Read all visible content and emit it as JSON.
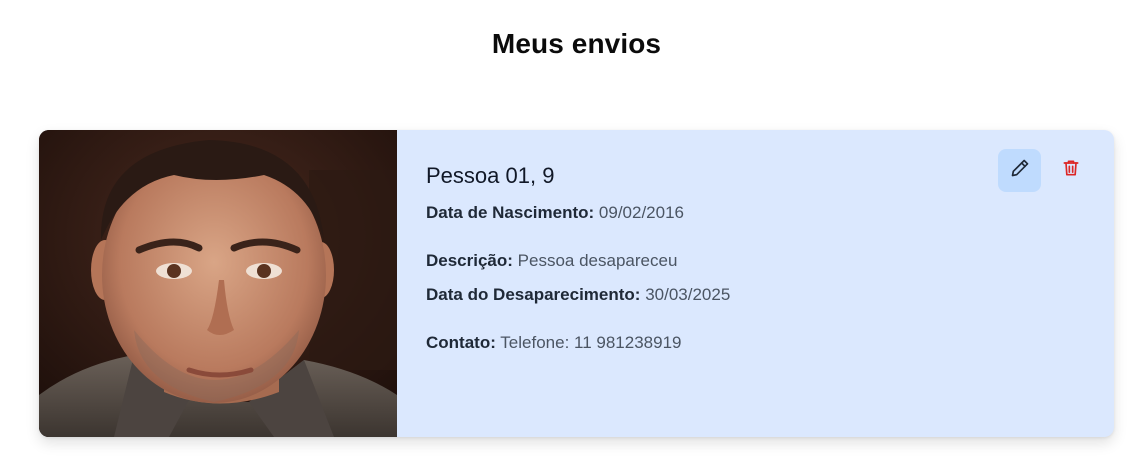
{
  "page": {
    "title": "Meus envios"
  },
  "card": {
    "name": "Pessoa 01, 9",
    "birth_label": "Data de Nascimento:",
    "birth_value": "09/02/2016",
    "description_label": "Descrição:",
    "description_value": "Pessoa desapareceu",
    "disappearance_label": "Data do Desaparecimento:",
    "disappearance_value": "30/03/2025",
    "contact_label": "Contato:",
    "contact_value": "Telefone: 11 981238919",
    "actions": {
      "edit_icon": "pencil-icon",
      "delete_icon": "trash-icon"
    }
  },
  "colors": {
    "card_background": "#dbe8fe",
    "edit_button_background": "#bfdbfe",
    "delete_icon": "#dc2626"
  }
}
